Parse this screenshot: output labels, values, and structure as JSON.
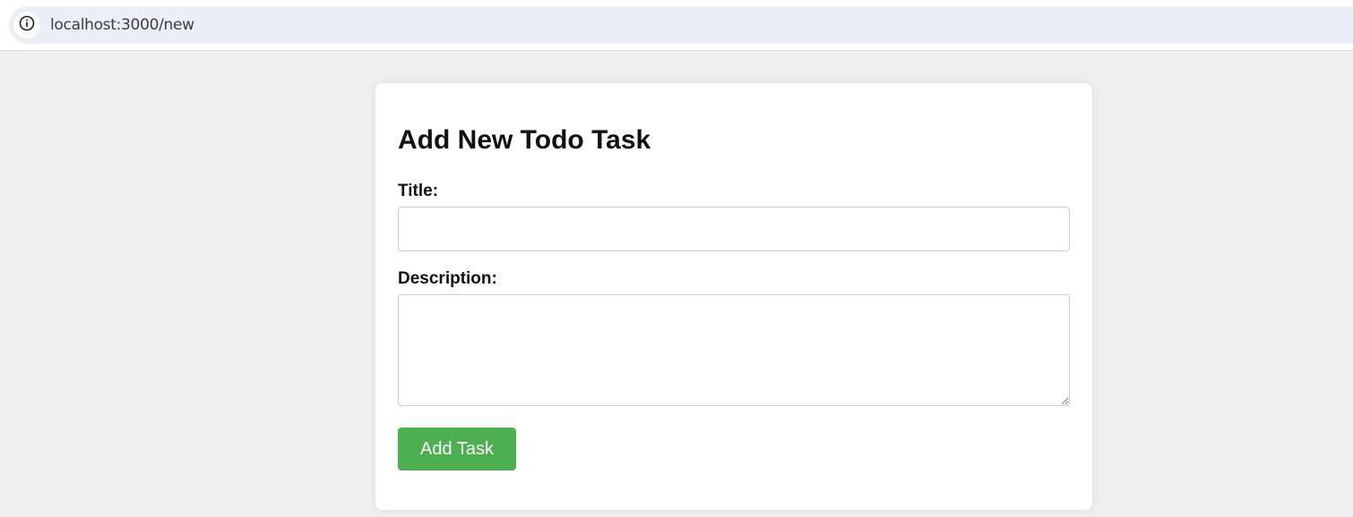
{
  "browser": {
    "url": "localhost:3000/new",
    "info_icon": "info-icon"
  },
  "form": {
    "heading": "Add New Todo Task",
    "title_label": "Title:",
    "title_value": "",
    "description_label": "Description:",
    "description_value": "",
    "submit_label": "Add Task"
  },
  "colors": {
    "accent": "#4caf50",
    "page_background": "#efefef",
    "card_background": "#ffffff",
    "address_bar": "#eaeef6"
  }
}
